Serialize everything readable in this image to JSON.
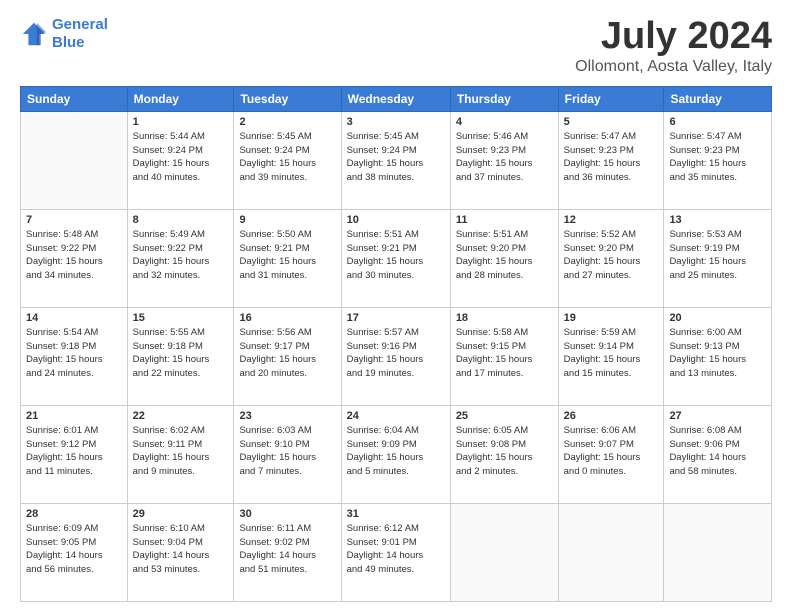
{
  "logo": {
    "line1": "General",
    "line2": "Blue"
  },
  "title": "July 2024",
  "subtitle": "Ollomont, Aosta Valley, Italy",
  "weekdays": [
    "Sunday",
    "Monday",
    "Tuesday",
    "Wednesday",
    "Thursday",
    "Friday",
    "Saturday"
  ],
  "weeks": [
    [
      {
        "day": "",
        "info": ""
      },
      {
        "day": "1",
        "info": "Sunrise: 5:44 AM\nSunset: 9:24 PM\nDaylight: 15 hours\nand 40 minutes."
      },
      {
        "day": "2",
        "info": "Sunrise: 5:45 AM\nSunset: 9:24 PM\nDaylight: 15 hours\nand 39 minutes."
      },
      {
        "day": "3",
        "info": "Sunrise: 5:45 AM\nSunset: 9:24 PM\nDaylight: 15 hours\nand 38 minutes."
      },
      {
        "day": "4",
        "info": "Sunrise: 5:46 AM\nSunset: 9:23 PM\nDaylight: 15 hours\nand 37 minutes."
      },
      {
        "day": "5",
        "info": "Sunrise: 5:47 AM\nSunset: 9:23 PM\nDaylight: 15 hours\nand 36 minutes."
      },
      {
        "day": "6",
        "info": "Sunrise: 5:47 AM\nSunset: 9:23 PM\nDaylight: 15 hours\nand 35 minutes."
      }
    ],
    [
      {
        "day": "7",
        "info": "Sunrise: 5:48 AM\nSunset: 9:22 PM\nDaylight: 15 hours\nand 34 minutes."
      },
      {
        "day": "8",
        "info": "Sunrise: 5:49 AM\nSunset: 9:22 PM\nDaylight: 15 hours\nand 32 minutes."
      },
      {
        "day": "9",
        "info": "Sunrise: 5:50 AM\nSunset: 9:21 PM\nDaylight: 15 hours\nand 31 minutes."
      },
      {
        "day": "10",
        "info": "Sunrise: 5:51 AM\nSunset: 9:21 PM\nDaylight: 15 hours\nand 30 minutes."
      },
      {
        "day": "11",
        "info": "Sunrise: 5:51 AM\nSunset: 9:20 PM\nDaylight: 15 hours\nand 28 minutes."
      },
      {
        "day": "12",
        "info": "Sunrise: 5:52 AM\nSunset: 9:20 PM\nDaylight: 15 hours\nand 27 minutes."
      },
      {
        "day": "13",
        "info": "Sunrise: 5:53 AM\nSunset: 9:19 PM\nDaylight: 15 hours\nand 25 minutes."
      }
    ],
    [
      {
        "day": "14",
        "info": "Sunrise: 5:54 AM\nSunset: 9:18 PM\nDaylight: 15 hours\nand 24 minutes."
      },
      {
        "day": "15",
        "info": "Sunrise: 5:55 AM\nSunset: 9:18 PM\nDaylight: 15 hours\nand 22 minutes."
      },
      {
        "day": "16",
        "info": "Sunrise: 5:56 AM\nSunset: 9:17 PM\nDaylight: 15 hours\nand 20 minutes."
      },
      {
        "day": "17",
        "info": "Sunrise: 5:57 AM\nSunset: 9:16 PM\nDaylight: 15 hours\nand 19 minutes."
      },
      {
        "day": "18",
        "info": "Sunrise: 5:58 AM\nSunset: 9:15 PM\nDaylight: 15 hours\nand 17 minutes."
      },
      {
        "day": "19",
        "info": "Sunrise: 5:59 AM\nSunset: 9:14 PM\nDaylight: 15 hours\nand 15 minutes."
      },
      {
        "day": "20",
        "info": "Sunrise: 6:00 AM\nSunset: 9:13 PM\nDaylight: 15 hours\nand 13 minutes."
      }
    ],
    [
      {
        "day": "21",
        "info": "Sunrise: 6:01 AM\nSunset: 9:12 PM\nDaylight: 15 hours\nand 11 minutes."
      },
      {
        "day": "22",
        "info": "Sunrise: 6:02 AM\nSunset: 9:11 PM\nDaylight: 15 hours\nand 9 minutes."
      },
      {
        "day": "23",
        "info": "Sunrise: 6:03 AM\nSunset: 9:10 PM\nDaylight: 15 hours\nand 7 minutes."
      },
      {
        "day": "24",
        "info": "Sunrise: 6:04 AM\nSunset: 9:09 PM\nDaylight: 15 hours\nand 5 minutes."
      },
      {
        "day": "25",
        "info": "Sunrise: 6:05 AM\nSunset: 9:08 PM\nDaylight: 15 hours\nand 2 minutes."
      },
      {
        "day": "26",
        "info": "Sunrise: 6:06 AM\nSunset: 9:07 PM\nDaylight: 15 hours\nand 0 minutes."
      },
      {
        "day": "27",
        "info": "Sunrise: 6:08 AM\nSunset: 9:06 PM\nDaylight: 14 hours\nand 58 minutes."
      }
    ],
    [
      {
        "day": "28",
        "info": "Sunrise: 6:09 AM\nSunset: 9:05 PM\nDaylight: 14 hours\nand 56 minutes."
      },
      {
        "day": "29",
        "info": "Sunrise: 6:10 AM\nSunset: 9:04 PM\nDaylight: 14 hours\nand 53 minutes."
      },
      {
        "day": "30",
        "info": "Sunrise: 6:11 AM\nSunset: 9:02 PM\nDaylight: 14 hours\nand 51 minutes."
      },
      {
        "day": "31",
        "info": "Sunrise: 6:12 AM\nSunset: 9:01 PM\nDaylight: 14 hours\nand 49 minutes."
      },
      {
        "day": "",
        "info": ""
      },
      {
        "day": "",
        "info": ""
      },
      {
        "day": "",
        "info": ""
      }
    ]
  ]
}
